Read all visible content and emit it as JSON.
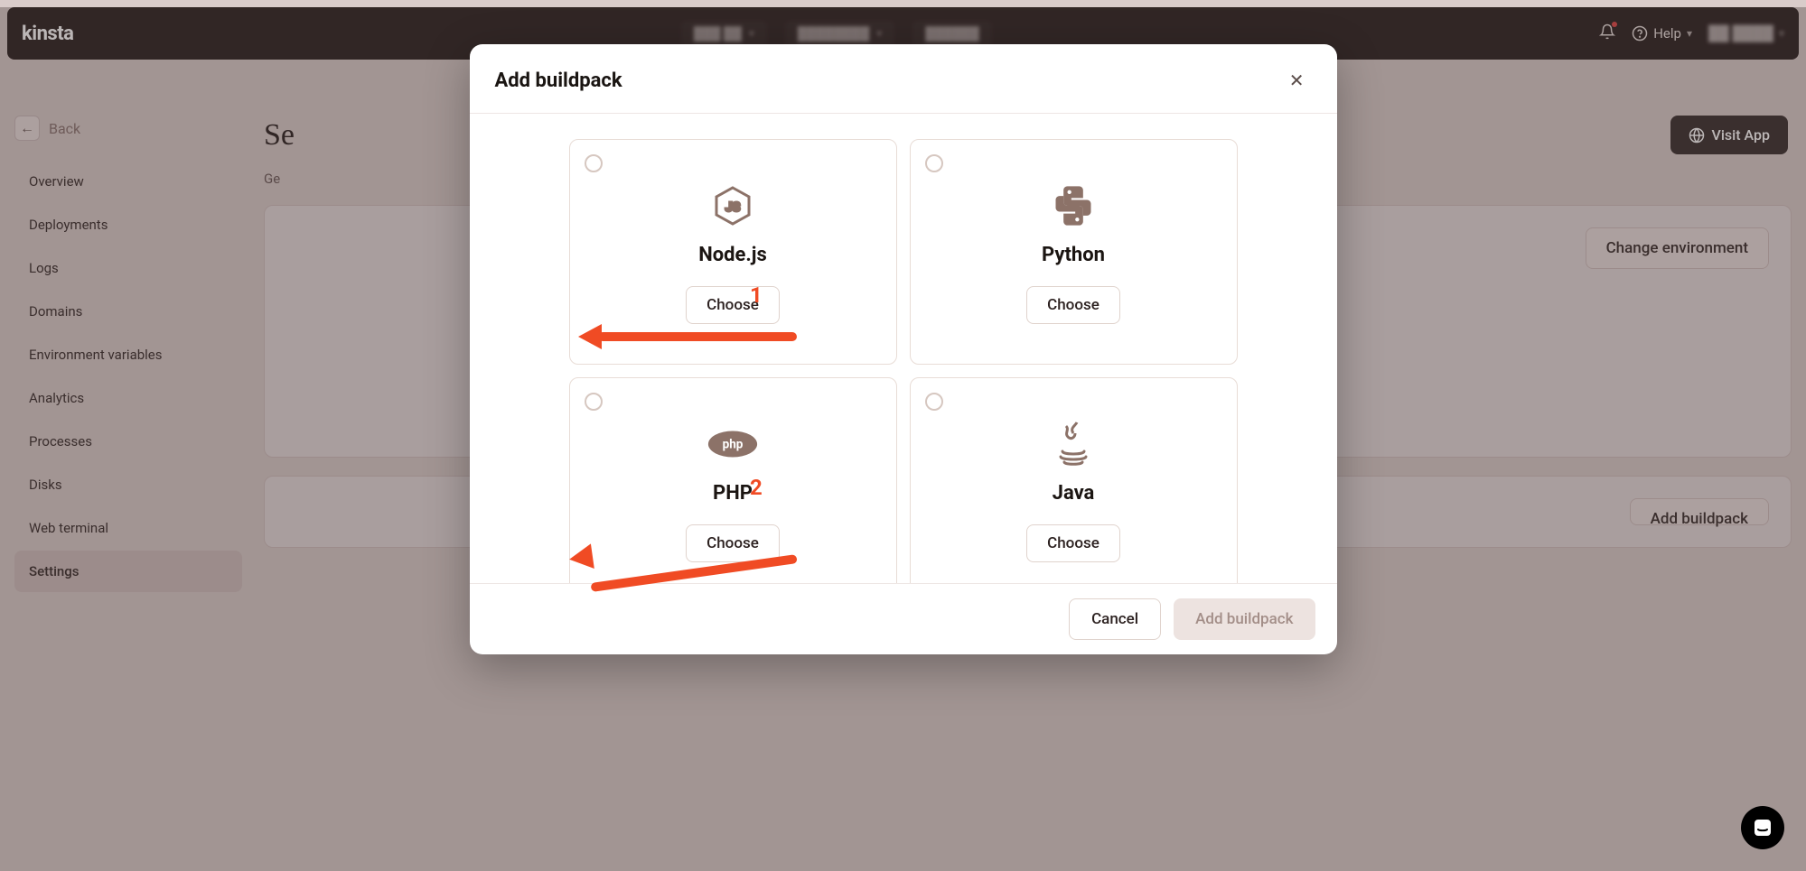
{
  "topbar": {
    "logo": "kinsta",
    "help_label": "Help"
  },
  "back_label": "Back",
  "page_title": "Se",
  "visit_app": "Visit App",
  "sub_tab": "Ge",
  "sidebar": {
    "items": [
      {
        "label": "Overview"
      },
      {
        "label": "Deployments"
      },
      {
        "label": "Logs"
      },
      {
        "label": "Domains"
      },
      {
        "label": "Environment variables"
      },
      {
        "label": "Analytics"
      },
      {
        "label": "Processes"
      },
      {
        "label": "Disks"
      },
      {
        "label": "Web terminal"
      },
      {
        "label": "Settings"
      }
    ],
    "active_index": 9
  },
  "right_card_buttons": {
    "change_env": "Change environment",
    "add_buildpack_ghost": "Add buildpack"
  },
  "modal": {
    "title": "Add buildpack",
    "buildpacks": [
      {
        "name": "Node.js",
        "choose": "Choose"
      },
      {
        "name": "Python",
        "choose": "Choose"
      },
      {
        "name": "PHP",
        "choose": "Choose"
      },
      {
        "name": "Java",
        "choose": "Choose"
      }
    ],
    "cancel": "Cancel",
    "submit": "Add buildpack"
  },
  "annotations": {
    "one": "1",
    "two": "2"
  }
}
